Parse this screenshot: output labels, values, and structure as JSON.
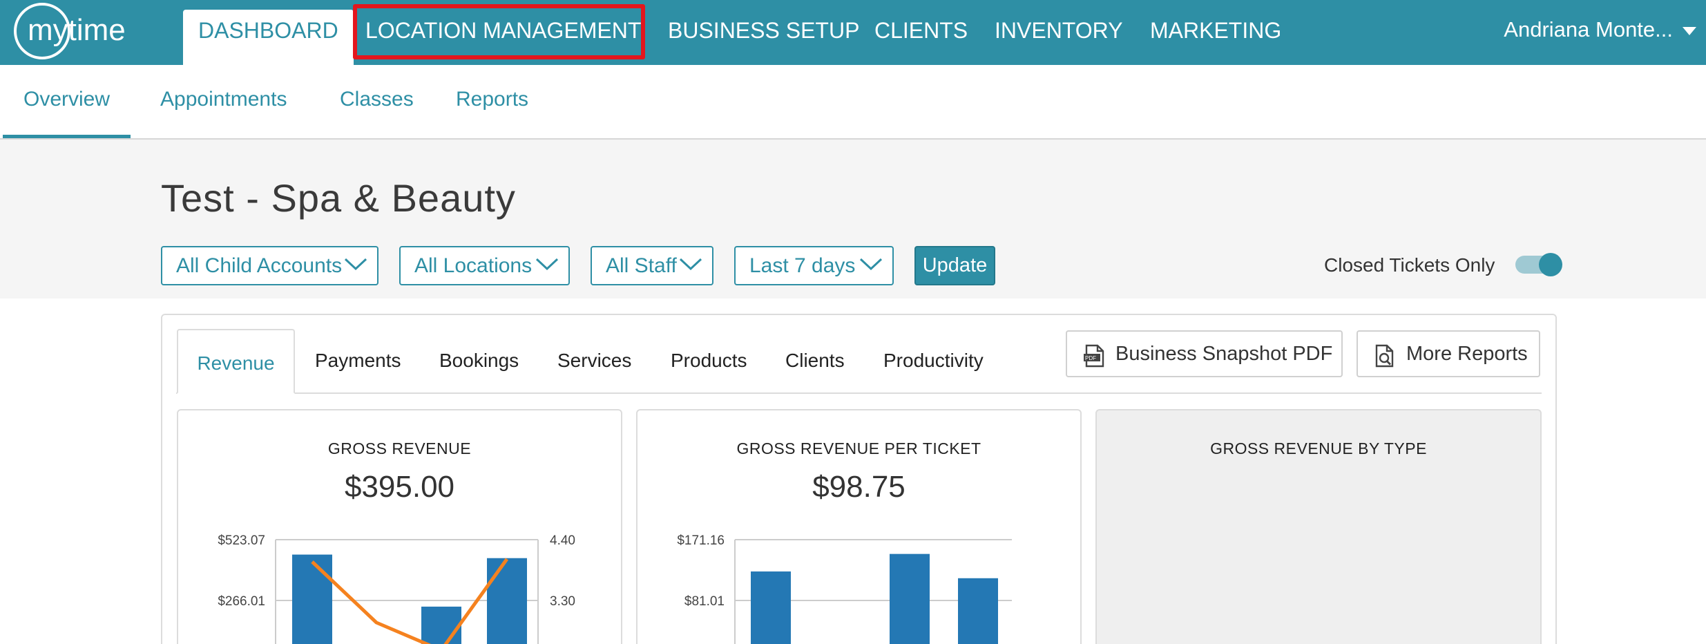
{
  "app": {
    "logo_text": "mytime",
    "colors": {
      "brand": "#2e8fa5",
      "highlight": "#e3161d",
      "bar": "#2478b4",
      "line": "#f5821f"
    }
  },
  "topnav": {
    "items": [
      {
        "label": "DASHBOARD"
      },
      {
        "label": "LOCATION MANAGEMENT"
      },
      {
        "label": "BUSINESS SETUP"
      },
      {
        "label": "CLIENTS"
      },
      {
        "label": "INVENTORY"
      },
      {
        "label": "MARKETING"
      }
    ],
    "user": "Andriana Monte..."
  },
  "subnav": {
    "items": [
      {
        "label": "Overview"
      },
      {
        "label": "Appointments"
      },
      {
        "label": "Classes"
      },
      {
        "label": "Reports"
      }
    ]
  },
  "header": {
    "title": "Test - Spa & Beauty",
    "filters": [
      {
        "value": "All Child Accounts"
      },
      {
        "value": "All Locations"
      },
      {
        "value": "All Staff"
      },
      {
        "value": "Last 7 days"
      }
    ],
    "update_label": "Update",
    "toggle_label": "Closed Tickets Only",
    "toggle_on": true
  },
  "report": {
    "tabs": [
      {
        "label": "Revenue"
      },
      {
        "label": "Payments"
      },
      {
        "label": "Bookings"
      },
      {
        "label": "Services"
      },
      {
        "label": "Products"
      },
      {
        "label": "Clients"
      },
      {
        "label": "Productivity"
      }
    ],
    "snapshot_label": "Business Snapshot PDF",
    "more_reports_label": "More Reports",
    "pdf_icon_text": "PDF"
  },
  "cards": [
    {
      "title": "GROSS REVENUE",
      "value": "$395.00"
    },
    {
      "title": "GROSS REVENUE PER TICKET",
      "value": "$98.75"
    },
    {
      "title": "GROSS REVENUE BY TYPE"
    }
  ],
  "chart_data": [
    {
      "type": "bar",
      "y_ticks": [
        "$523.07",
        "$266.01"
      ],
      "y2_ticks": [
        "4.40",
        "3.30"
      ],
      "grid": true,
      "bars": [
        {
          "value": 460
        },
        {
          "value": 0
        },
        {
          "value": 240
        },
        {
          "value": 445
        }
      ],
      "line_series": [
        {
          "y2": 4.0
        },
        {
          "y2": 2.9
        },
        {
          "y2": 2.4
        },
        {
          "y2": 4.05
        }
      ]
    },
    {
      "type": "bar",
      "y_ticks": [
        "$171.16",
        "$81.01"
      ],
      "grid": true,
      "bars": [
        {
          "value": 124
        },
        {
          "value": 0
        },
        {
          "value": 150
        },
        {
          "value": 114
        }
      ]
    }
  ]
}
